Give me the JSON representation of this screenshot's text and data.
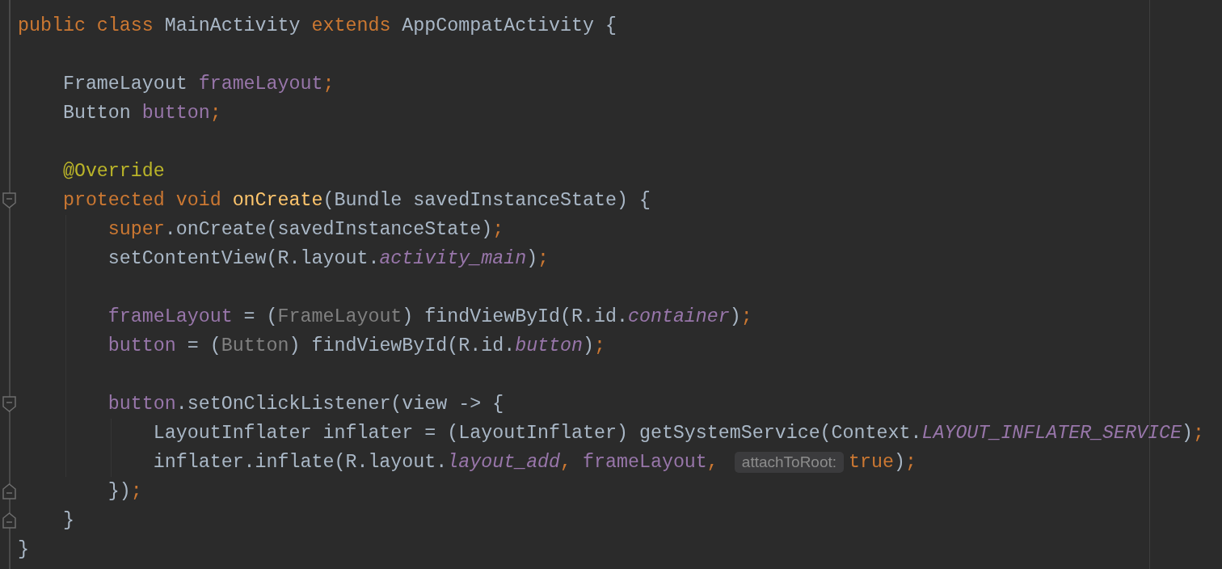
{
  "editor": {
    "lines": [
      {
        "tokens": [
          {
            "kind": "keyword",
            "text": "public class "
          },
          {
            "kind": "plain",
            "text": "MainActivity "
          },
          {
            "kind": "keyword",
            "text": "extends "
          },
          {
            "kind": "plain",
            "text": "AppCompatActivity {"
          }
        ]
      },
      {
        "blank_line_before": true,
        "tokens": [
          {
            "kind": "plain",
            "text": "    FrameLayout "
          },
          {
            "kind": "field",
            "text": "frameLayout"
          },
          {
            "kind": "keyword",
            "text": ";"
          }
        ]
      },
      {
        "tokens": [
          {
            "kind": "plain",
            "text": "    Button "
          },
          {
            "kind": "field",
            "text": "button"
          },
          {
            "kind": "keyword",
            "text": ";"
          }
        ]
      },
      {
        "blank_line_before": true,
        "tokens": [
          {
            "kind": "annotation",
            "text": "    @Override"
          }
        ]
      },
      {
        "fold_start": true,
        "tokens": [
          {
            "kind": "keyword",
            "text": "    protected void "
          },
          {
            "kind": "method",
            "text": "onCreate"
          },
          {
            "kind": "plain",
            "text": "(Bundle savedInstanceState) {"
          }
        ]
      },
      {
        "tokens": [
          {
            "kind": "keyword",
            "text": "        super"
          },
          {
            "kind": "plain",
            "text": ".onCreate(savedInstanceState)"
          },
          {
            "kind": "keyword",
            "text": ";"
          }
        ]
      },
      {
        "tokens": [
          {
            "kind": "plain",
            "text": "        setContentView(R.layout."
          },
          {
            "kind": "constant",
            "text": "activity_main"
          },
          {
            "kind": "plain",
            "text": ")"
          },
          {
            "kind": "keyword",
            "text": ";"
          }
        ]
      },
      {
        "blank_line_before": true,
        "tokens": [
          {
            "kind": "field",
            "text": "        frameLayout"
          },
          {
            "kind": "plain",
            "text": " = ("
          },
          {
            "kind": "cast",
            "text": "FrameLayout"
          },
          {
            "kind": "plain",
            "text": ") findViewById(R.id."
          },
          {
            "kind": "constant",
            "text": "container"
          },
          {
            "kind": "plain",
            "text": ")"
          },
          {
            "kind": "keyword",
            "text": ";"
          }
        ]
      },
      {
        "tokens": [
          {
            "kind": "field",
            "text": "        button"
          },
          {
            "kind": "plain",
            "text": " = ("
          },
          {
            "kind": "cast",
            "text": "Button"
          },
          {
            "kind": "plain",
            "text": ") findViewById(R.id."
          },
          {
            "kind": "constant",
            "text": "button"
          },
          {
            "kind": "plain",
            "text": ")"
          },
          {
            "kind": "keyword",
            "text": ";"
          }
        ]
      },
      {
        "blank_line_before": true,
        "fold_start": true,
        "tokens": [
          {
            "kind": "field",
            "text": "        button"
          },
          {
            "kind": "plain",
            "text": ".setOnClickListener(view -> {"
          }
        ]
      },
      {
        "tokens": [
          {
            "kind": "plain",
            "text": "            LayoutInflater inflater = (LayoutInflater) getSystemService(Context."
          },
          {
            "kind": "constant",
            "text": "LAYOUT_INFLATER_SERVICE"
          },
          {
            "kind": "plain",
            "text": ")"
          },
          {
            "kind": "keyword",
            "text": ";"
          }
        ]
      },
      {
        "tokens": [
          {
            "kind": "plain",
            "text": "            inflater.inflate(R.layout."
          },
          {
            "kind": "constant",
            "text": "layout_add"
          },
          {
            "kind": "keyword",
            "text": ", "
          },
          {
            "kind": "field",
            "text": "frameLayout"
          },
          {
            "kind": "keyword",
            "text": ", "
          },
          {
            "kind": "hint",
            "text": "attachToRoot:"
          },
          {
            "kind": "keyword",
            "text": "true"
          },
          {
            "kind": "plain",
            "text": ")"
          },
          {
            "kind": "keyword",
            "text": ";"
          }
        ]
      },
      {
        "fold_end": true,
        "tokens": [
          {
            "kind": "plain",
            "text": "        })"
          },
          {
            "kind": "keyword",
            "text": ";"
          }
        ]
      },
      {
        "fold_end": true,
        "tokens": [
          {
            "kind": "plain",
            "text": "    }"
          }
        ]
      },
      {
        "tokens": [
          {
            "kind": "plain",
            "text": "}"
          }
        ]
      }
    ]
  }
}
